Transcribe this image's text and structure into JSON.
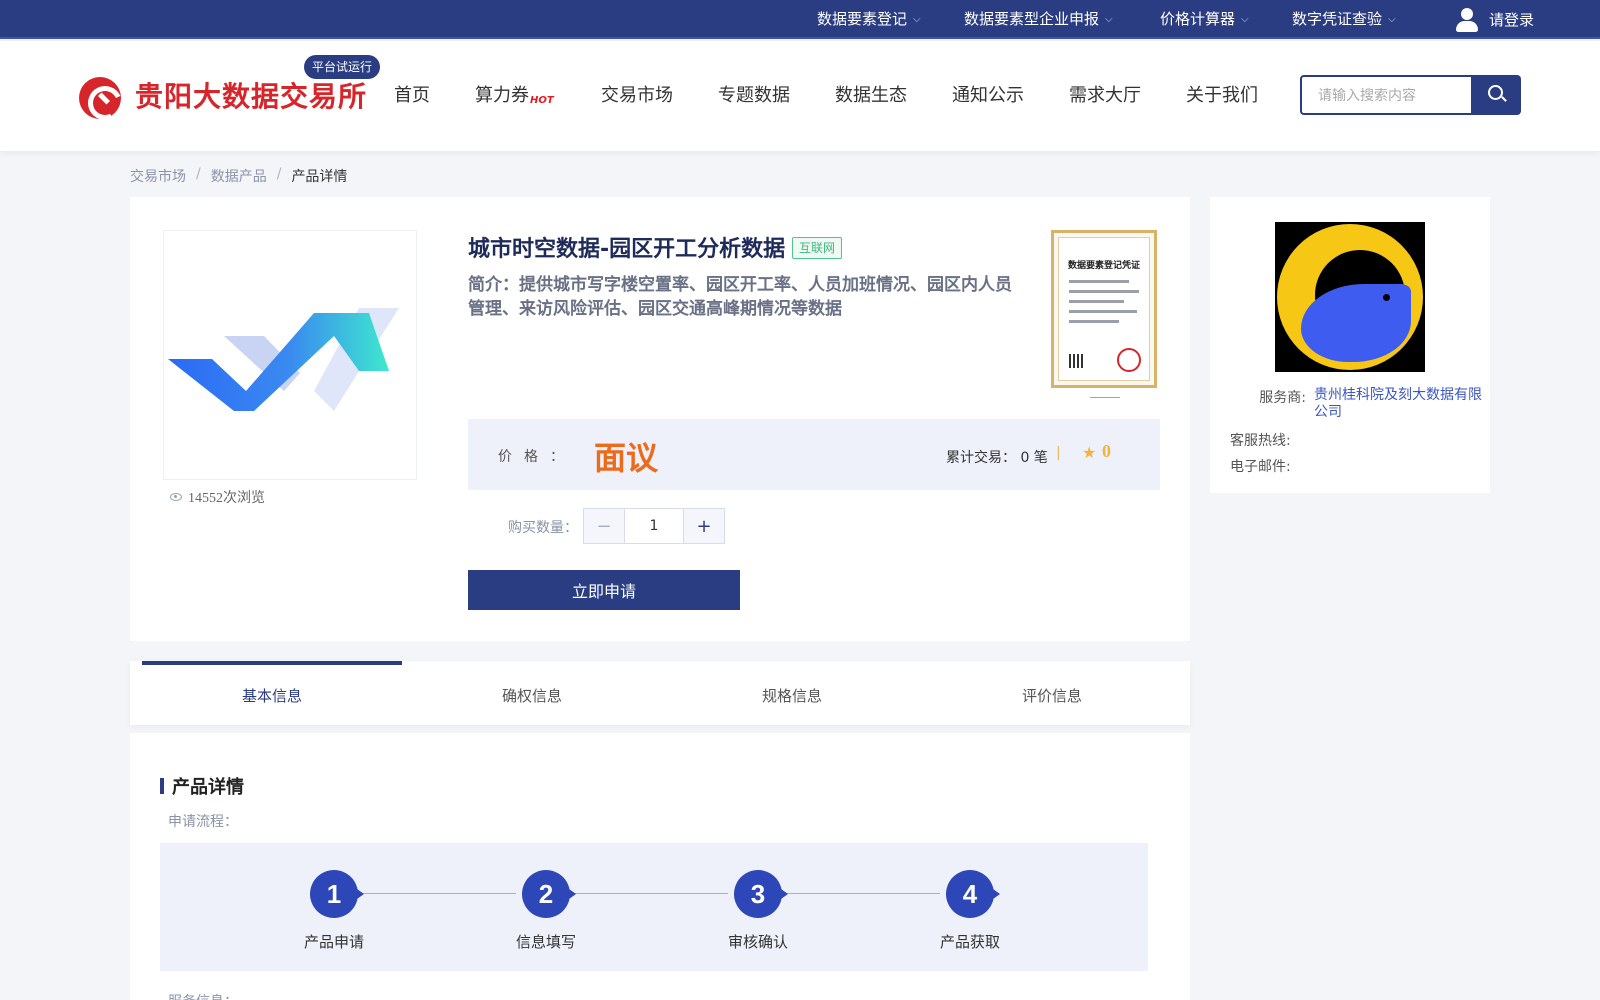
{
  "topbar": {
    "items": [
      {
        "label": "数据要素登记"
      },
      {
        "label": "数据要素型企业申报"
      },
      {
        "label": "价格计算器"
      },
      {
        "label": "数字凭证查验"
      }
    ],
    "login_label": "请登录"
  },
  "header": {
    "logo_text": "贵阳大数据交易所",
    "trial_badge": "平台试运行",
    "nav": [
      "首页",
      "算力券",
      "交易市场",
      "专题数据",
      "数据生态",
      "通知公示",
      "需求大厅",
      "关于我们"
    ],
    "hot_label": "HOT",
    "search_placeholder": "请输入搜索内容"
  },
  "breadcrumb": [
    "交易市场",
    "数据产品",
    "产品详情"
  ],
  "product": {
    "title": "城市时空数据-园区开工分析数据",
    "tag": "互联网",
    "summary": "简介：提供城市写字楼空置率、园区开工率、人员加班情况、园区内人员管理、来访风险评估、园区交通高峰期情况等数据",
    "views": "14552次浏览",
    "certificate_title": "数据要素登记凭证",
    "price_label": "价格",
    "price_value": "面议",
    "trade_count": "累计交易：  0 笔",
    "divider": "|",
    "rating": "0",
    "qty_label": "购买数量：",
    "qty_minus": "−",
    "qty_value": "1",
    "qty_plus": "+",
    "apply_label": "立即申请"
  },
  "vendor": {
    "provider_label": "服务商:",
    "provider_value": "贵州桂科院及刻大数据有限公司",
    "hotline_label": "客服热线:",
    "email_label": "电子邮件:"
  },
  "tabs": [
    "基本信息",
    "确权信息",
    "规格信息",
    "评价信息"
  ],
  "detail": {
    "section_title": "产品详情",
    "flow_label": "申请流程：",
    "steps": [
      {
        "num": "1",
        "label": "产品申请"
      },
      {
        "num": "2",
        "label": "信息填写"
      },
      {
        "num": "3",
        "label": "审核确认"
      },
      {
        "num": "4",
        "label": "产品获取"
      }
    ],
    "service_label": "服务信息："
  },
  "colors": {
    "brand_navy": "#2a3d82",
    "brand_red": "#d7262b",
    "price_orange": "#ec6b1c",
    "tag_green": "#3fb77f",
    "star_gold": "#f2b33d"
  }
}
